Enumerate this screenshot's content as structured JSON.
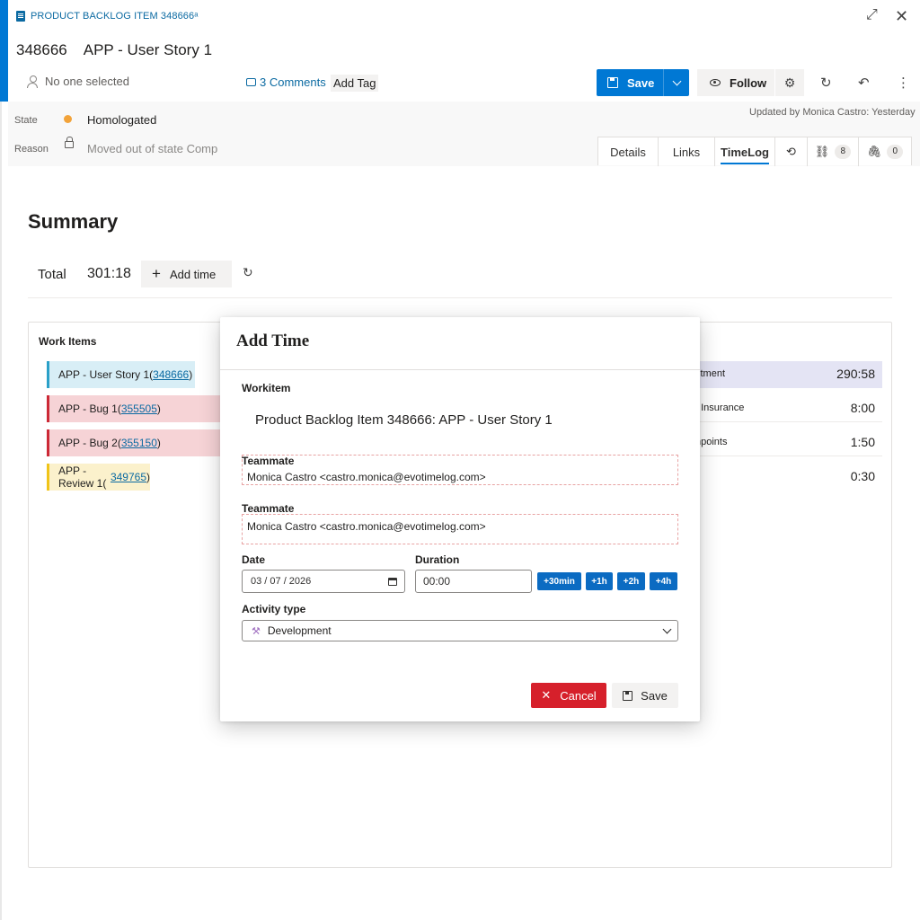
{
  "header": {
    "type_label": "PRODUCT BACKLOG ITEM 348666ᵃ",
    "id": "348666",
    "title": "APP - User Story 1",
    "assignee": "No one selected",
    "comments": "3 Comments",
    "add_tag": "Add Tag"
  },
  "toolbar": {
    "save_label": "Save",
    "follow_label": "Follow"
  },
  "state": {
    "state_label": "State",
    "state_value": "Homologated",
    "state_color": "#f2a33a",
    "reason_label": "Reason",
    "reason_value": "Moved out of state Comp",
    "updated": "Updated by Monica Castro: Yesterday"
  },
  "tabs": {
    "details": "Details",
    "links": "Links",
    "timelog": "TimeLog",
    "links_count": "8",
    "attachments_count": "0"
  },
  "summary": {
    "heading": "Summary",
    "total_label": "Total",
    "total_value": "301:18",
    "add_time": "Add time"
  },
  "work_items": {
    "title": "Work Items",
    "items": [
      {
        "name": "APP - User Story 1(",
        "id": "348666",
        "close": ")",
        "color": "#2aa0c8"
      },
      {
        "name": "APP - Bug 1(",
        "id": "355505",
        "close": ")",
        "color": "#cc2936"
      },
      {
        "name": "APP - Bug 2(",
        "id": "355150",
        "close": ")",
        "color": "#cc2936"
      },
      {
        "name": "APP - Review 1(",
        "id": "349765",
        "close": ")",
        "color": "#f0c419"
      }
    ]
  },
  "activities": {
    "rows": [
      {
        "name": "stment",
        "value": "290:58"
      },
      {
        "name": ": Insurance",
        "value": "8:00"
      },
      {
        "name": "npoints",
        "value": "1:50"
      },
      {
        "name": "",
        "value": "0:30"
      }
    ]
  },
  "modal": {
    "title": "Add Time",
    "workitem_label": "Workitem",
    "workitem_value": "Product Backlog Item 348666: APP - User Story 1",
    "teammate_label": "Teammate",
    "teammate_value": "Monica Castro <castro.monica@evotimelog.com>",
    "teammate2_label": "Teammate",
    "teammate2_value": "Monica Castro <castro.monica@evotimelog.com>",
    "date_label": "Date",
    "date_value": "03 / 07 / 2026",
    "duration_label": "Duration",
    "duration_value": "00:00",
    "quick_add": [
      "+30min",
      "+1h",
      "+2h",
      "+4h"
    ],
    "activity_label": "Activity type",
    "activity_value": "Development",
    "cancel_label": "Cancel",
    "save_label": "Save"
  },
  "icons": {
    "accent": "#0078d4",
    "danger": "#d6202b"
  }
}
